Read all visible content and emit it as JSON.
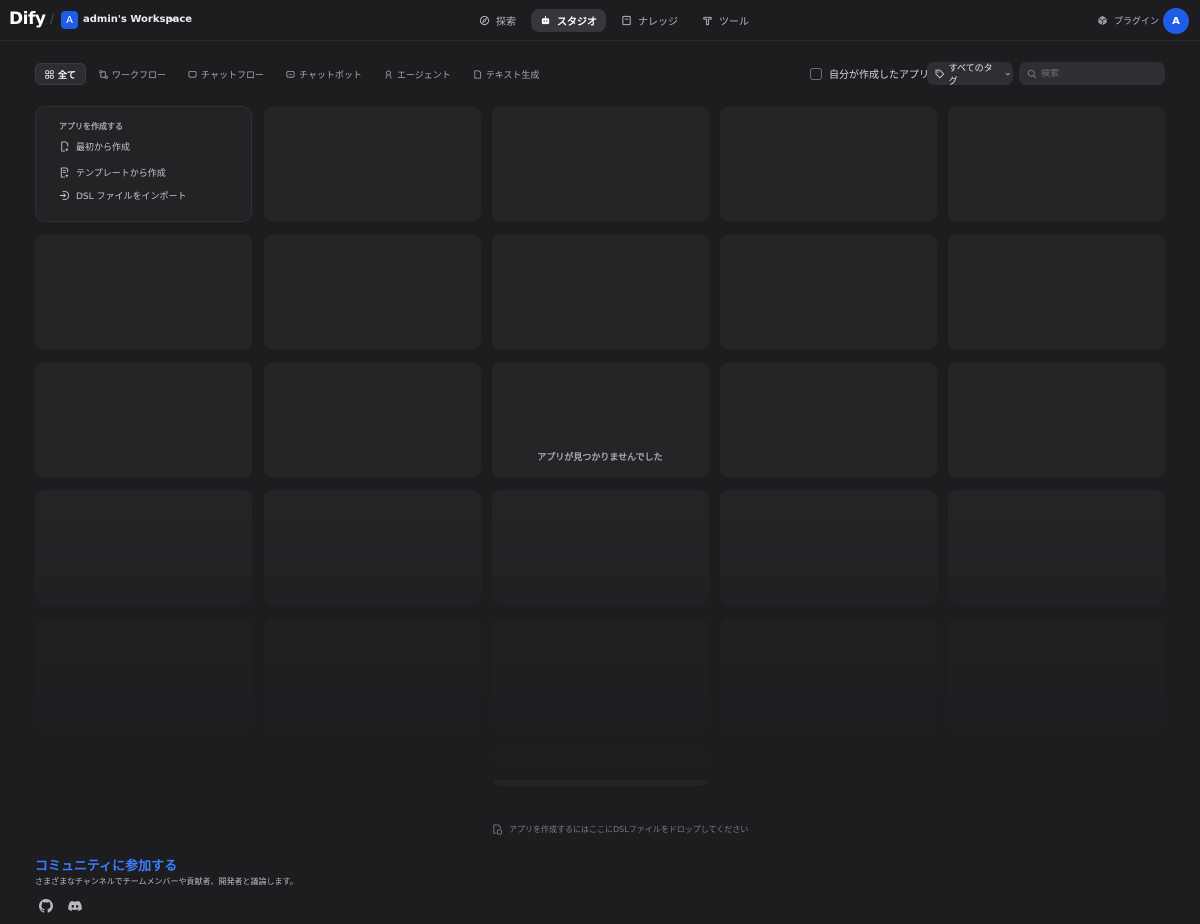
{
  "header": {
    "logo": "Dify",
    "workspace_initial": "A",
    "workspace_name": "admin's Workspace",
    "nav": [
      {
        "label": "探索",
        "icon": "compass-icon"
      },
      {
        "label": "スタジオ",
        "icon": "robot-icon",
        "active": true
      },
      {
        "label": "ナレッジ",
        "icon": "book-icon"
      },
      {
        "label": "ツール",
        "icon": "hammer-icon"
      }
    ],
    "plugin_label": "プラグイン",
    "user_initial": "A"
  },
  "filters": {
    "tabs": [
      {
        "label": "全て",
        "icon": "grid-icon",
        "active": true
      },
      {
        "label": "ワークフロー",
        "icon": "workflow-icon"
      },
      {
        "label": "チャットフロー",
        "icon": "chat-bubble-icon"
      },
      {
        "label": "チャットボット",
        "icon": "chatbot-icon"
      },
      {
        "label": "エージェント",
        "icon": "agent-icon"
      },
      {
        "label": "テキスト生成",
        "icon": "document-icon"
      }
    ],
    "mine_label": "自分が作成したアプリ",
    "tags_label": "すべてのタグ",
    "search_placeholder": "検索"
  },
  "create_card": {
    "title": "アプリを作成する",
    "items": [
      {
        "label": "最初から作成",
        "icon": "blank-file-icon"
      },
      {
        "label": "テンプレートから作成",
        "icon": "template-icon"
      },
      {
        "label": "DSL ファイルをインポート",
        "icon": "import-icon"
      }
    ]
  },
  "empty_message": "アプリが見つかりませんでした",
  "drop_hint": "アプリを作成するにはここにDSLファイルをドロップしてください",
  "community": {
    "title": "コミュニティに参加する",
    "description": "さまざまなチャンネルでチームメンバーや貢献者、開発者と議論します。",
    "links": [
      "github-icon",
      "discord-icon"
    ]
  },
  "colors": {
    "background": "#1d1d20",
    "card": "#252528",
    "accent": "#1e5de8",
    "link": "#3d7bff"
  }
}
